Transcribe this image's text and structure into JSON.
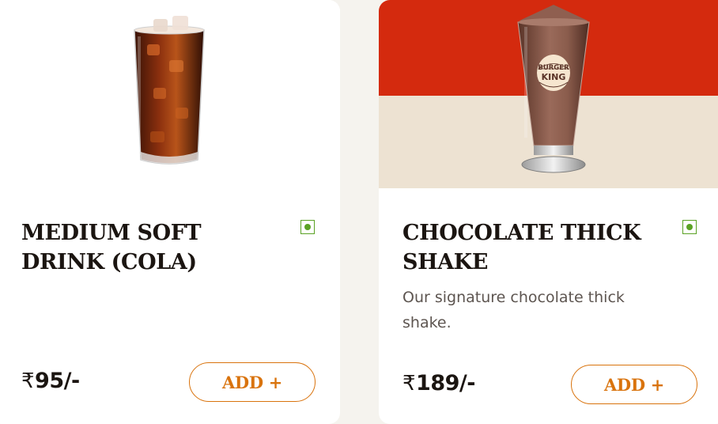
{
  "products": [
    {
      "name": "MEDIUM SOFT DRINK (COLA)",
      "description": "",
      "price_symbol": "₹",
      "price_value": "95/-",
      "add_label": "ADD +",
      "veg": true
    },
    {
      "name": "CHOCOLATE THICK SHAKE",
      "description": "Our signature chocolate thick shake.",
      "price_symbol": "₹",
      "price_value": "189/-",
      "add_label": "ADD +",
      "veg": true,
      "logo_text_top": "BURGER",
      "logo_text_bottom": "KING"
    }
  ],
  "colors": {
    "accent": "#d9730d",
    "veg": "#5aa224",
    "banner_red": "#d42a0e",
    "banner_cream": "#ede2d2"
  },
  "icons": {
    "veg_indicator": "veg-indicator-icon"
  }
}
